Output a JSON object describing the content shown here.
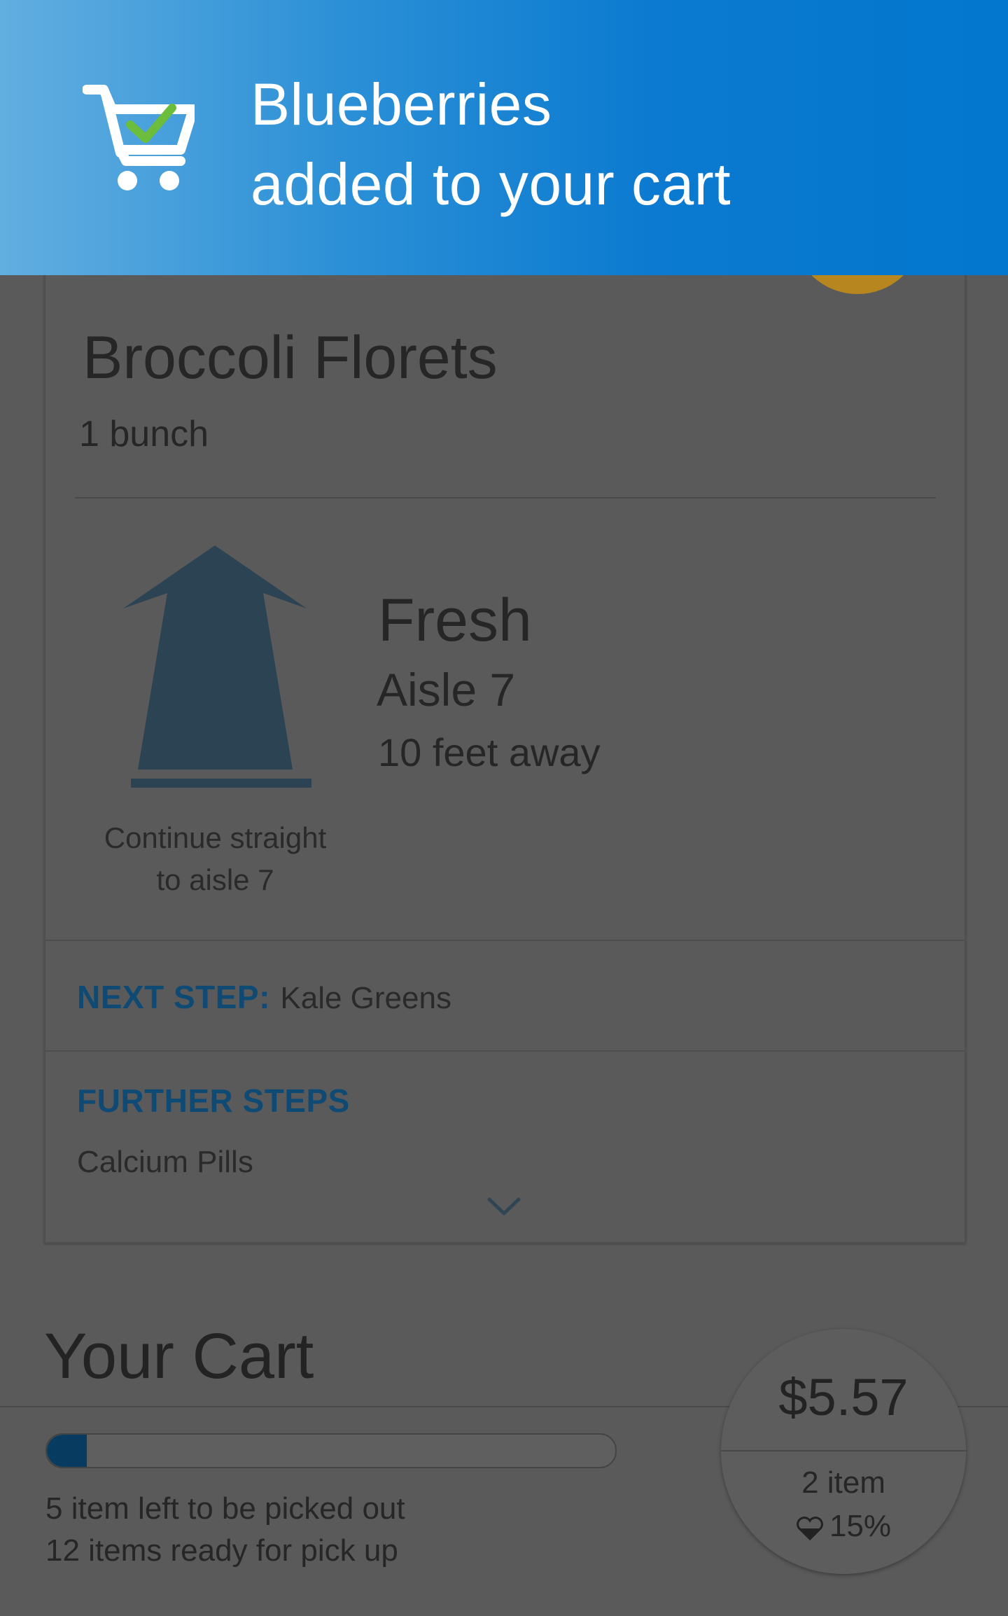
{
  "toast": {
    "line1": "Blueberries",
    "line2": "added to your cart",
    "icon": "cart-check-icon",
    "check_color": "#6bbd3b"
  },
  "product": {
    "name": "Broccoli Florets",
    "quantity": "1 bunch"
  },
  "directions": {
    "icon": "straight-arrow-icon",
    "caption_line1": "Continue straight",
    "caption_line2": "to aisle 7",
    "section": "Fresh",
    "aisle": "Aisle 7",
    "distance": "10 feet away"
  },
  "steps": {
    "next_label": "NEXT STEP:",
    "next_value": "Kale Greens",
    "further_label": "FURTHER STEPS",
    "further_items": [
      "Calcium Pills"
    ]
  },
  "cart": {
    "title": "Your Cart",
    "progress_fraction": 0.07,
    "left_text": "5 item left to be picked out",
    "ready_text": "12 items ready for pick up",
    "total": "$5.57",
    "items": "2 item",
    "discount": "15%"
  },
  "colors": {
    "banner": "#0277cd",
    "accent_text": "#0f4a75",
    "arrow": "#2c4353",
    "progress": "#073b60"
  }
}
